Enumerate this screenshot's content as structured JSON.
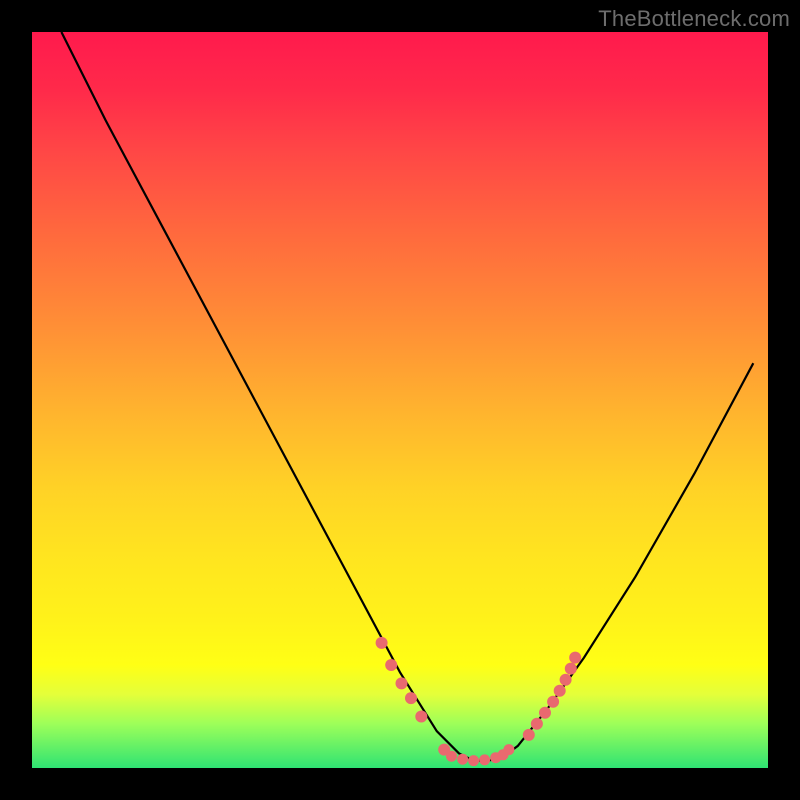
{
  "watermark": "TheBottleneck.com",
  "colors": {
    "background": "#000000",
    "curve": "#000000",
    "dots": "#e9696f",
    "gradient_top": "#ff1a4d",
    "gradient_bottom": "#2fe373"
  },
  "chart_data": {
    "type": "line",
    "title": "",
    "xlabel": "",
    "ylabel": "",
    "xlim": [
      0,
      100
    ],
    "ylim": [
      0,
      100
    ],
    "annotations": [
      "TheBottleneck.com"
    ],
    "series": [
      {
        "name": "bottleneck-curve",
        "x": [
          4,
          10,
          18,
          26,
          34,
          42,
          50,
          55,
          58,
          60,
          62,
          64,
          66,
          70,
          75,
          82,
          90,
          98
        ],
        "y": [
          100,
          88,
          73,
          58,
          43,
          28,
          13,
          5,
          2,
          1,
          1,
          1.5,
          3,
          8,
          15,
          26,
          40,
          55
        ]
      }
    ],
    "left_branch_dots": {
      "x": [
        47.5,
        48.8,
        50.2,
        51.5,
        52.9,
        56.0
      ],
      "y": [
        17.0,
        14.0,
        11.5,
        9.5,
        7.0,
        2.5
      ]
    },
    "valley_dots": {
      "x": [
        57.0,
        58.5,
        60.0,
        61.5,
        63.0,
        64.0,
        64.8
      ],
      "y": [
        1.6,
        1.2,
        1.0,
        1.1,
        1.4,
        1.8,
        2.5
      ]
    },
    "right_branch_dots": {
      "x": [
        67.5,
        68.6,
        69.7,
        70.8,
        71.7,
        72.5,
        73.2,
        73.8
      ],
      "y": [
        4.5,
        6.0,
        7.5,
        9.0,
        10.5,
        12.0,
        13.5,
        15.0
      ]
    }
  }
}
